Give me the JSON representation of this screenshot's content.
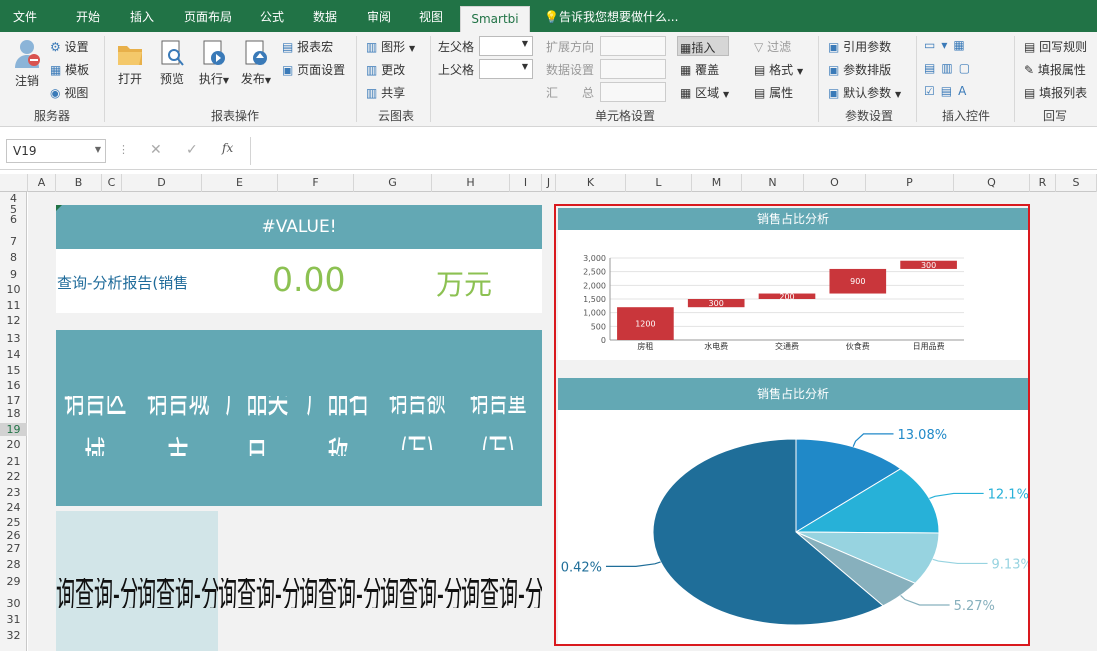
{
  "tabs": [
    {
      "label": "文件"
    },
    {
      "label": "开始"
    },
    {
      "label": "插入"
    },
    {
      "label": "页面布局"
    },
    {
      "label": "公式"
    },
    {
      "label": "数据"
    },
    {
      "label": "审阅"
    },
    {
      "label": "视图"
    },
    {
      "label": "Smartbi"
    }
  ],
  "tell_me": "告诉我您想要做什么...",
  "ribbon": {
    "server": {
      "logout": "注销",
      "settings": "设置",
      "template": "模板",
      "view": "视图",
      "group": "服务器"
    },
    "report_ops": {
      "open": "打开",
      "preview": "预览",
      "execute": "执行",
      "publish": "发布",
      "macro": "报表宏",
      "page_setup": "页面设置",
      "group": "报表操作"
    },
    "cloud": {
      "shape": "图形",
      "change": "更改",
      "share": "共享",
      "group": "云图表"
    },
    "cell": {
      "left_parent": "左父格",
      "top_parent": "上父格",
      "expand_dir": "扩展方向",
      "data_setting": "数据设置",
      "summary": "汇　　总",
      "insert": "插入",
      "cover": "覆盖",
      "area": "区域",
      "filter": "过滤",
      "format": "格式",
      "attribute": "属性",
      "group": "单元格设置"
    },
    "params": {
      "ref_param": "引用参数",
      "param_layout": "参数排版",
      "default_param": "默认参数",
      "group": "参数设置"
    },
    "controls": {
      "group": "插入控件"
    },
    "writeback": {
      "rule": "回写规则",
      "fill_attr": "填报属性",
      "fill_list": "填报列表",
      "group": "回写"
    }
  },
  "formula_bar": {
    "name_box": "V19",
    "fx": "fx",
    "cancel": "✕",
    "confirm": "✓"
  },
  "columns": [
    "A",
    "B",
    "C",
    "D",
    "E",
    "F",
    "G",
    "H",
    "I",
    "J",
    "K",
    "L",
    "M",
    "N",
    "O",
    "P",
    "Q",
    "R",
    "S"
  ],
  "rows": [
    "4",
    "5",
    "6",
    "7",
    "8",
    "9",
    "10",
    "11",
    "12",
    "13",
    "14",
    "15",
    "16",
    "17",
    "18",
    "19",
    "20",
    "21",
    "22",
    "23",
    "24",
    "25",
    "26",
    "27",
    "28",
    "29",
    "30",
    "31",
    "32"
  ],
  "sheet": {
    "title_value": "#VALUE!",
    "query_label": "查询-分析报告(销售",
    "amount": "0.00",
    "unit": "万元",
    "headers": [
      "销售区域",
      "销售城市",
      "产品类目",
      "产品名称",
      "销售额(万)",
      "销售量(万)"
    ],
    "row_text": "询查询-分析报"
  },
  "colors": {
    "header_teal": "#63a8b4",
    "green_value": "#8cc152",
    "blue_text": "#1f6b9a",
    "bar_red": "#c9363b",
    "selection_border": "#d9191e"
  },
  "charts": [
    {
      "title": "销售占比分析",
      "type": "bar"
    },
    {
      "title": "销售占比分析",
      "type": "pie"
    }
  ],
  "chart_data": [
    {
      "type": "bar",
      "title": "销售占比分析",
      "categories": [
        "房租",
        "水电费",
        "交通费",
        "伙食费",
        "日用品费"
      ],
      "values": [
        1200,
        300,
        200,
        900,
        300
      ],
      "offsets": [
        0,
        1200,
        1500,
        1700,
        2600
      ],
      "ylim": [
        0,
        3000
      ],
      "yticks": [
        "0",
        "500",
        "1,000",
        "1,500",
        "2,000",
        "2,500",
        "3,000"
      ],
      "grid": true,
      "bar_color": "#c9363b"
    },
    {
      "type": "pie",
      "title": "销售占比分析",
      "values": [
        13.08,
        12.1,
        9.13,
        5.27,
        60.42
      ],
      "labels": [
        "13.08%",
        "12.1%",
        "9.13%",
        "5.27%",
        "0.42%"
      ],
      "colors": [
        "#2089c8",
        "#27b1d8",
        "#97d3e0",
        "#87b0bd",
        "#1f6e99"
      ]
    }
  ]
}
